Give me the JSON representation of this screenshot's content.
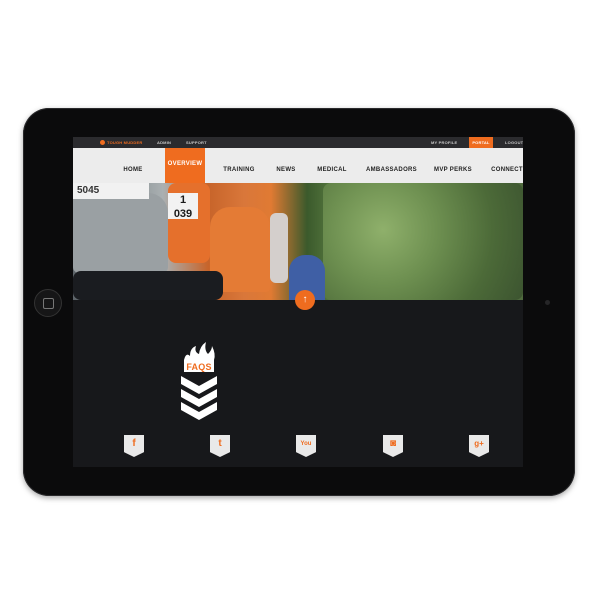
{
  "topbar": {
    "logo_text": "TOUGH MUDDER",
    "links": [
      "ADMIN",
      "SUPPORT"
    ],
    "right_links": [
      "MY PROFILE",
      "PORTAL",
      "LOGOUT"
    ]
  },
  "nav": {
    "items": [
      "HOME",
      "OVERVIEW",
      "TRAINING",
      "NEWS",
      "MEDICAL",
      "AMBASSADORS",
      "MVP PERKS",
      "CONNECT"
    ],
    "active": "OVERVIEW"
  },
  "hero": {
    "bib_number": "039",
    "bib_number_2": "1",
    "bib_left": "5045"
  },
  "faq": {
    "label": "FAQS"
  },
  "social": {
    "items": [
      {
        "name": "facebook-icon",
        "glyph": "f"
      },
      {
        "name": "twitter-icon",
        "glyph": "t"
      },
      {
        "name": "youtube-icon",
        "glyph": "You"
      },
      {
        "name": "instagram-icon",
        "glyph": "◙"
      },
      {
        "name": "google-plus-icon",
        "glyph": "g+"
      }
    ]
  },
  "colors": {
    "accent": "#ef6c1f",
    "nav_bg": "#ececec",
    "screen_bg": "#17181b",
    "device": "#0b0b0c"
  }
}
